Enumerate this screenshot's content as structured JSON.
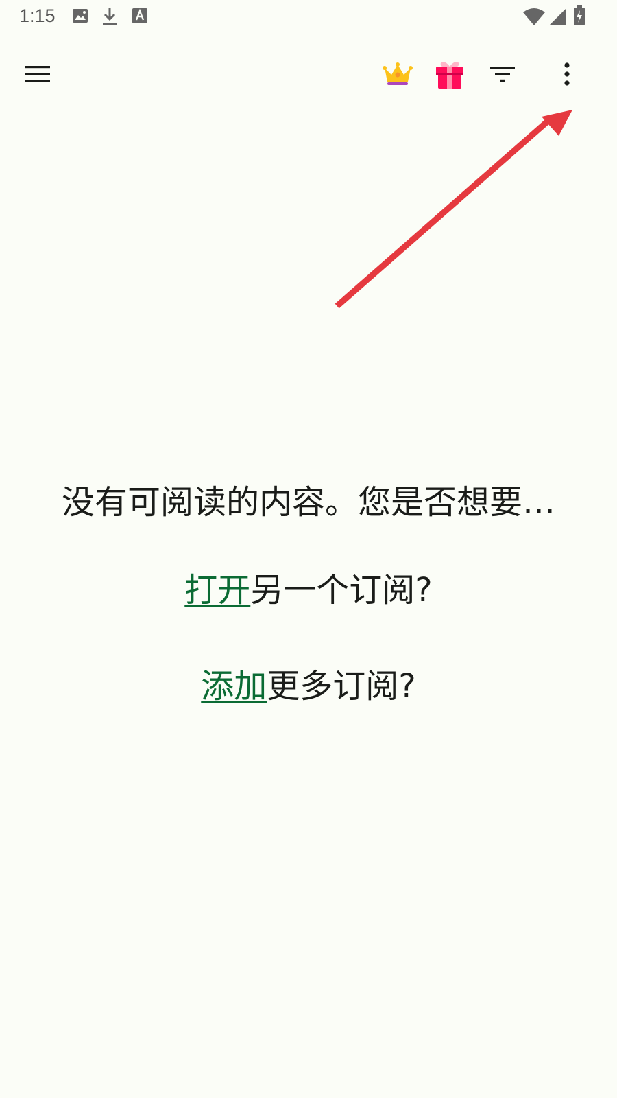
{
  "status_bar": {
    "time": "1:15",
    "icons": [
      "image-notification-icon",
      "download-icon",
      "text-notification-icon",
      "wifi-icon",
      "signal-icon",
      "battery-charging-icon"
    ]
  },
  "app_bar": {
    "menu_icon": "menu-icon",
    "actions": [
      "crown-icon",
      "gift-icon",
      "filter-icon",
      "more-vert-icon"
    ]
  },
  "empty_state": {
    "title": "没有可阅读的内容。您是否想要…",
    "option_open_link": "打开",
    "option_open_rest": "另一个订阅?",
    "option_add_link": "添加",
    "option_add_rest": "更多订阅?"
  },
  "colors": {
    "background": "#fbfdf7",
    "text": "#1a1c19",
    "link": "#0b6b34",
    "annotation_arrow": "#e5393f",
    "crown": "#fcc21b",
    "gift": "#ff0d5a"
  }
}
